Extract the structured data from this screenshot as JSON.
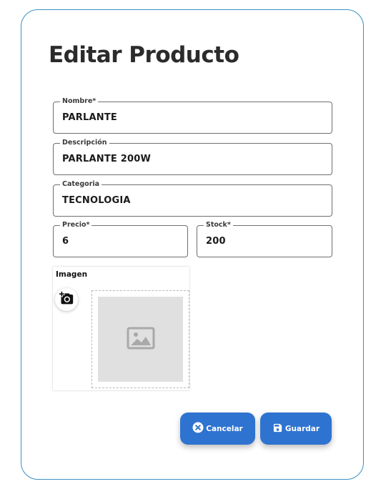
{
  "form": {
    "title": "Editar Producto",
    "fields": {
      "nombre": {
        "label": "Nombre*",
        "value": "PARLANTE"
      },
      "descripcion": {
        "label": "Descripción",
        "value": "PARLANTE 200W"
      },
      "categoria": {
        "label": "Categoria",
        "value": "TECNOLOGIA"
      },
      "precio": {
        "label": "Precio*",
        "value": "6"
      },
      "stock": {
        "label": "Stock*",
        "value": "200"
      }
    },
    "image": {
      "label": "Imagen"
    },
    "buttons": {
      "cancel": "Cancelar",
      "save": "Guardar"
    }
  },
  "colors": {
    "accent": "#2f73d0",
    "card_border": "#3a8fc4",
    "placeholder_bg": "#e0e0e0"
  },
  "icons": {
    "cancel": "cancel-circle-icon",
    "save": "save-floppy-icon",
    "camera": "add-photo-icon",
    "placeholder": "image-placeholder-icon"
  }
}
